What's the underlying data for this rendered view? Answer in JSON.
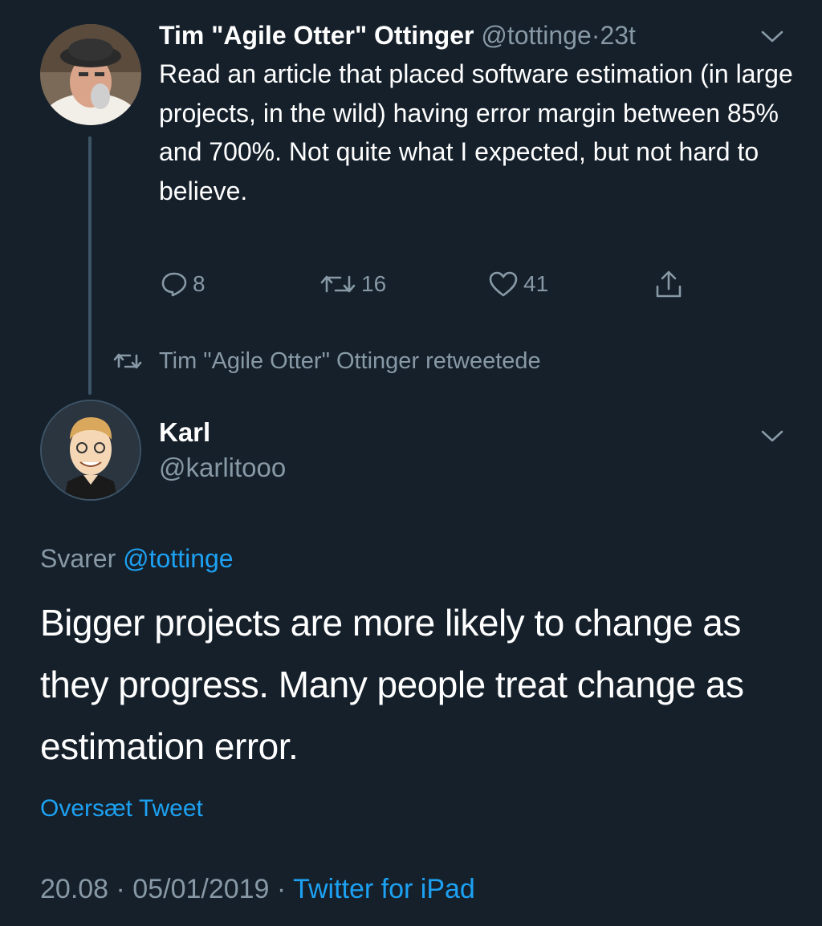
{
  "tweet1": {
    "name": "Tim \"Agile Otter\" Ottinger",
    "handle": "@tottinge",
    "separator": "·",
    "time": "23t",
    "text": "Read an article that placed software estimation (in large projects, in the wild) having error margin between 85% and 700%. Not quite what I expected, but not hard to believe.",
    "actions": {
      "reply_icon": "comment-icon",
      "reply_count": "8",
      "retweet_icon": "retweet-icon",
      "retweet_count": "16",
      "like_icon": "heart-icon",
      "like_count": "41",
      "share_icon": "share-icon"
    }
  },
  "retweet_note": {
    "icon": "retweet-icon",
    "text": "Tim \"Agile Otter\" Ottinger retweetede"
  },
  "tweet2": {
    "name": "Karl",
    "handle": "@karlitooo",
    "reply_prefix": "Svarer",
    "reply_to": "@tottinge",
    "text": "Bigger projects are more likely to change as they progress. Many people treat change as estimation error.",
    "translate": "Oversæt Tweet",
    "timestamp": "20.08 · 05/01/2019",
    "meta_sep": "·",
    "source": "Twitter for iPad"
  },
  "colors": {
    "background": "#15202b",
    "text": "#ffffff",
    "secondary": "#8899a6",
    "accent": "#1da1f2",
    "thread_line": "#3d5466"
  }
}
